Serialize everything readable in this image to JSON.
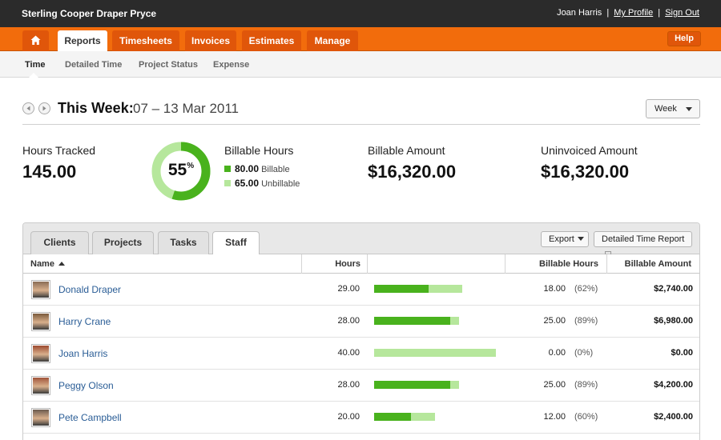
{
  "header": {
    "company": "Sterling Cooper Draper Pryce",
    "user": "Joan Harris",
    "separator": "|",
    "my_profile": "My Profile",
    "sign_out": "Sign Out"
  },
  "nav": {
    "home_icon": "home-icon",
    "tabs": [
      {
        "label": "Reports",
        "active": true
      },
      {
        "label": "Timesheets",
        "active": false
      },
      {
        "label": "Invoices",
        "active": false
      },
      {
        "label": "Estimates",
        "active": false
      },
      {
        "label": "Manage",
        "active": false
      }
    ],
    "help": "Help"
  },
  "subnav": {
    "items": [
      {
        "label": "Time",
        "active": true
      },
      {
        "label": "Detailed Time",
        "active": false
      },
      {
        "label": "Project Status",
        "active": false
      },
      {
        "label": "Expense",
        "active": false
      }
    ]
  },
  "period": {
    "label": "This Week:",
    "range": "07 – 13 Mar 2011",
    "selector": "Week"
  },
  "stats": {
    "hours_tracked_label": "Hours Tracked",
    "hours_tracked_value": "145.00",
    "billable_percent": "55",
    "billable_fraction": 0.55,
    "billable_hours_label": "Billable Hours",
    "billable_value": "80.00",
    "billable_label": "Billable",
    "unbillable_value": "65.00",
    "unbillable_label": "Unbillable",
    "billable_amount_label": "Billable Amount",
    "billable_amount_value": "$16,320.00",
    "uninvoiced_amount_label": "Uninvoiced Amount",
    "uninvoiced_amount_value": "$16,320.00"
  },
  "colors": {
    "accent": "#f26c0c",
    "billable": "#49b21d",
    "unbillable": "#b6e79c",
    "link": "#2a5d96"
  },
  "panel": {
    "tabs": [
      {
        "label": "Clients",
        "active": false
      },
      {
        "label": "Projects",
        "active": false
      },
      {
        "label": "Tasks",
        "active": false
      },
      {
        "label": "Staff",
        "active": true
      }
    ],
    "export": "Export",
    "detailed_report": "Detailed Time Report",
    "columns": {
      "name": "Name",
      "hours": "Hours",
      "billable_hours": "Billable Hours",
      "billable_amount": "Billable Amount"
    },
    "max_hours": 40,
    "rows": [
      {
        "name": "Donald Draper",
        "hours": "29.00",
        "hours_num": 29,
        "billable_hours": "18.00",
        "billable_num": 18,
        "pct": "(62%)",
        "amount": "$2,740.00"
      },
      {
        "name": "Harry Crane",
        "hours": "28.00",
        "hours_num": 28,
        "billable_hours": "25.00",
        "billable_num": 25,
        "pct": "(89%)",
        "amount": "$6,980.00"
      },
      {
        "name": "Joan Harris",
        "hours": "40.00",
        "hours_num": 40,
        "billable_hours": "0.00",
        "billable_num": 0,
        "pct": "(0%)",
        "amount": "$0.00"
      },
      {
        "name": "Peggy Olson",
        "hours": "28.00",
        "hours_num": 28,
        "billable_hours": "25.00",
        "billable_num": 25,
        "pct": "(89%)",
        "amount": "$4,200.00"
      },
      {
        "name": "Pete Campbell",
        "hours": "20.00",
        "hours_num": 20,
        "billable_hours": "12.00",
        "billable_num": 12,
        "pct": "(60%)",
        "amount": "$2,400.00"
      }
    ]
  }
}
